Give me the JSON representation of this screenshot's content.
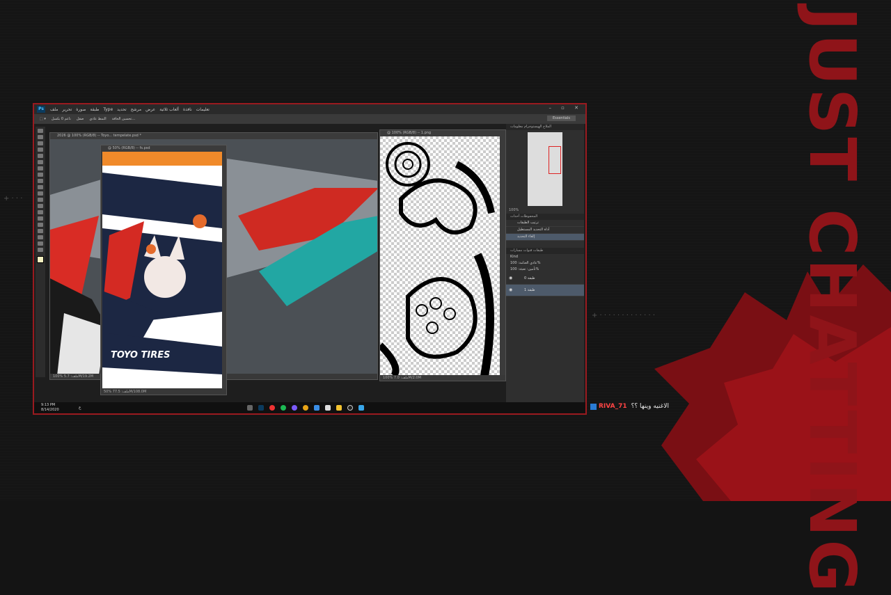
{
  "background": {
    "brand_text": "JUST CHATTING",
    "accent": "#9a1a1f"
  },
  "photoshop": {
    "menu": [
      "ملف",
      "تحرير",
      "صورة",
      "طبقة",
      "Type",
      "تحديد",
      "مرشح",
      "عرض",
      "ألعاب ثلاثية",
      "نافذة",
      "تعليمات"
    ],
    "options": {
      "feather": "ناعم 0 بكسل",
      "antialias": "صقل",
      "width_label": "النمط عادي",
      "refine": "تحسين الحافة..."
    },
    "workspace": "Essentials",
    "doc1": {
      "tab": "2026 @ 100% (RGB/8) -- Toyo... tempelate.psd *",
      "zoom": "100%",
      "info": "ملف: 5.7M/19.2M"
    },
    "doc2": {
      "tab": "@ 50% (RGB/8) -- fs.psd",
      "zoom": "50%",
      "info": "ملف: 77.5M/108.0M",
      "brand": "TOYO TIRES"
    },
    "doc3": {
      "tab": "@ 100% (RGB/8) -- 1.png",
      "zoom": "100%",
      "info": "ملف: 7.0M/2.0M"
    },
    "navigator_tabs": "الملاح  الهيستوجرام  معلومات",
    "navigator_zoom": "100%",
    "history_tabs": "المحفوظات  أحداث",
    "history": [
      "ترتيب الطبقات",
      "أداة التحديد المستطيل",
      "إلغاء التحديد"
    ],
    "layers_tabs": "طبقات  قنوات  مسارات",
    "layer_controls": {
      "kind": "Kind",
      "blend": "عادي",
      "opacity_label": "العتامة:",
      "opacity": "100%",
      "fill_label": "تعبئة:",
      "fill": "100%",
      "lock": "تأمين:"
    },
    "layers": [
      "طبقة 0",
      "طبقة 1"
    ]
  },
  "taskbar": {
    "time": "9:13 PM",
    "date": "8/14/2020",
    "lang": "ع"
  },
  "chat": {
    "user": "RIVA_71",
    "message": "الاغنيه وينها ؟؟",
    "user_color": "#ff4444"
  }
}
